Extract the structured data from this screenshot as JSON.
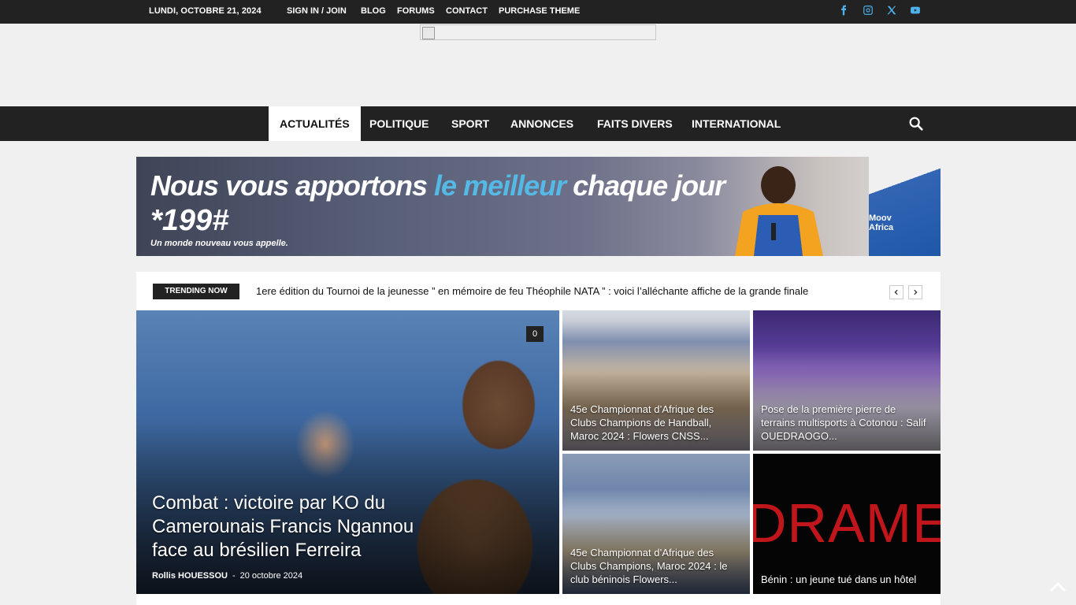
{
  "topbar": {
    "date": "LUNDI, OCTOBRE 21, 2024",
    "links": [
      "SIGN IN / JOIN",
      "BLOG",
      "FORUMS",
      "CONTACT",
      "PURCHASE THEME"
    ],
    "social_icons": [
      "facebook-icon",
      "instagram-icon",
      "x-icon",
      "youtube-icon"
    ],
    "social_color": "#4db2ec"
  },
  "nav": {
    "items": [
      "ACTUALITÉS",
      "POLITIQUE",
      "SPORT",
      "ANNONCES",
      "FAITS DIVERS",
      "INTERNATIONAL"
    ],
    "active": "ACTUALITÉS",
    "search_icon": "search-icon"
  },
  "ad": {
    "line1_pre": "Nous vous apportons ",
    "line1_highlight": "le meilleur",
    "line1_post": " chaque jour",
    "line2": "*199#",
    "line3": "Un monde nouveau vous appelle.",
    "brand_line1": "Moov",
    "brand_line2": "Africa"
  },
  "trending": {
    "label": "TRENDING NOW",
    "headline": "1ere édition du Tournoi de la jeunesse ” en mémoire de feu Théophile NATA ” : voici l’alléchante affiche de la grande finale"
  },
  "featured": {
    "title": "Combat : victoire par KO du Camerounais Francis Ngannou face au brésilien Ferreira",
    "author": "Rollis HOUESSOU",
    "separator": "-",
    "date": "20 octobre 2024",
    "comments": "0"
  },
  "tiles": [
    {
      "title": "45e Championnat d’Afrique des Clubs Champions de Handball, Maroc 2024 : Flowers CNSS..."
    },
    {
      "title": "Pose de la première pierre de terrains multisports à Cotonou : Salif OUEDRAOGO..."
    },
    {
      "title": "45e Championnat d’Afrique des Clubs Champions, Maroc 2024 : le club béninois Flowers..."
    },
    {
      "title": "Bénin : un jeune tué dans un hôtel",
      "image_word": "DRAME"
    }
  ],
  "colors": {
    "dark": "#222222",
    "accent": "#4db2ec",
    "drame_red": "#c0161b"
  }
}
